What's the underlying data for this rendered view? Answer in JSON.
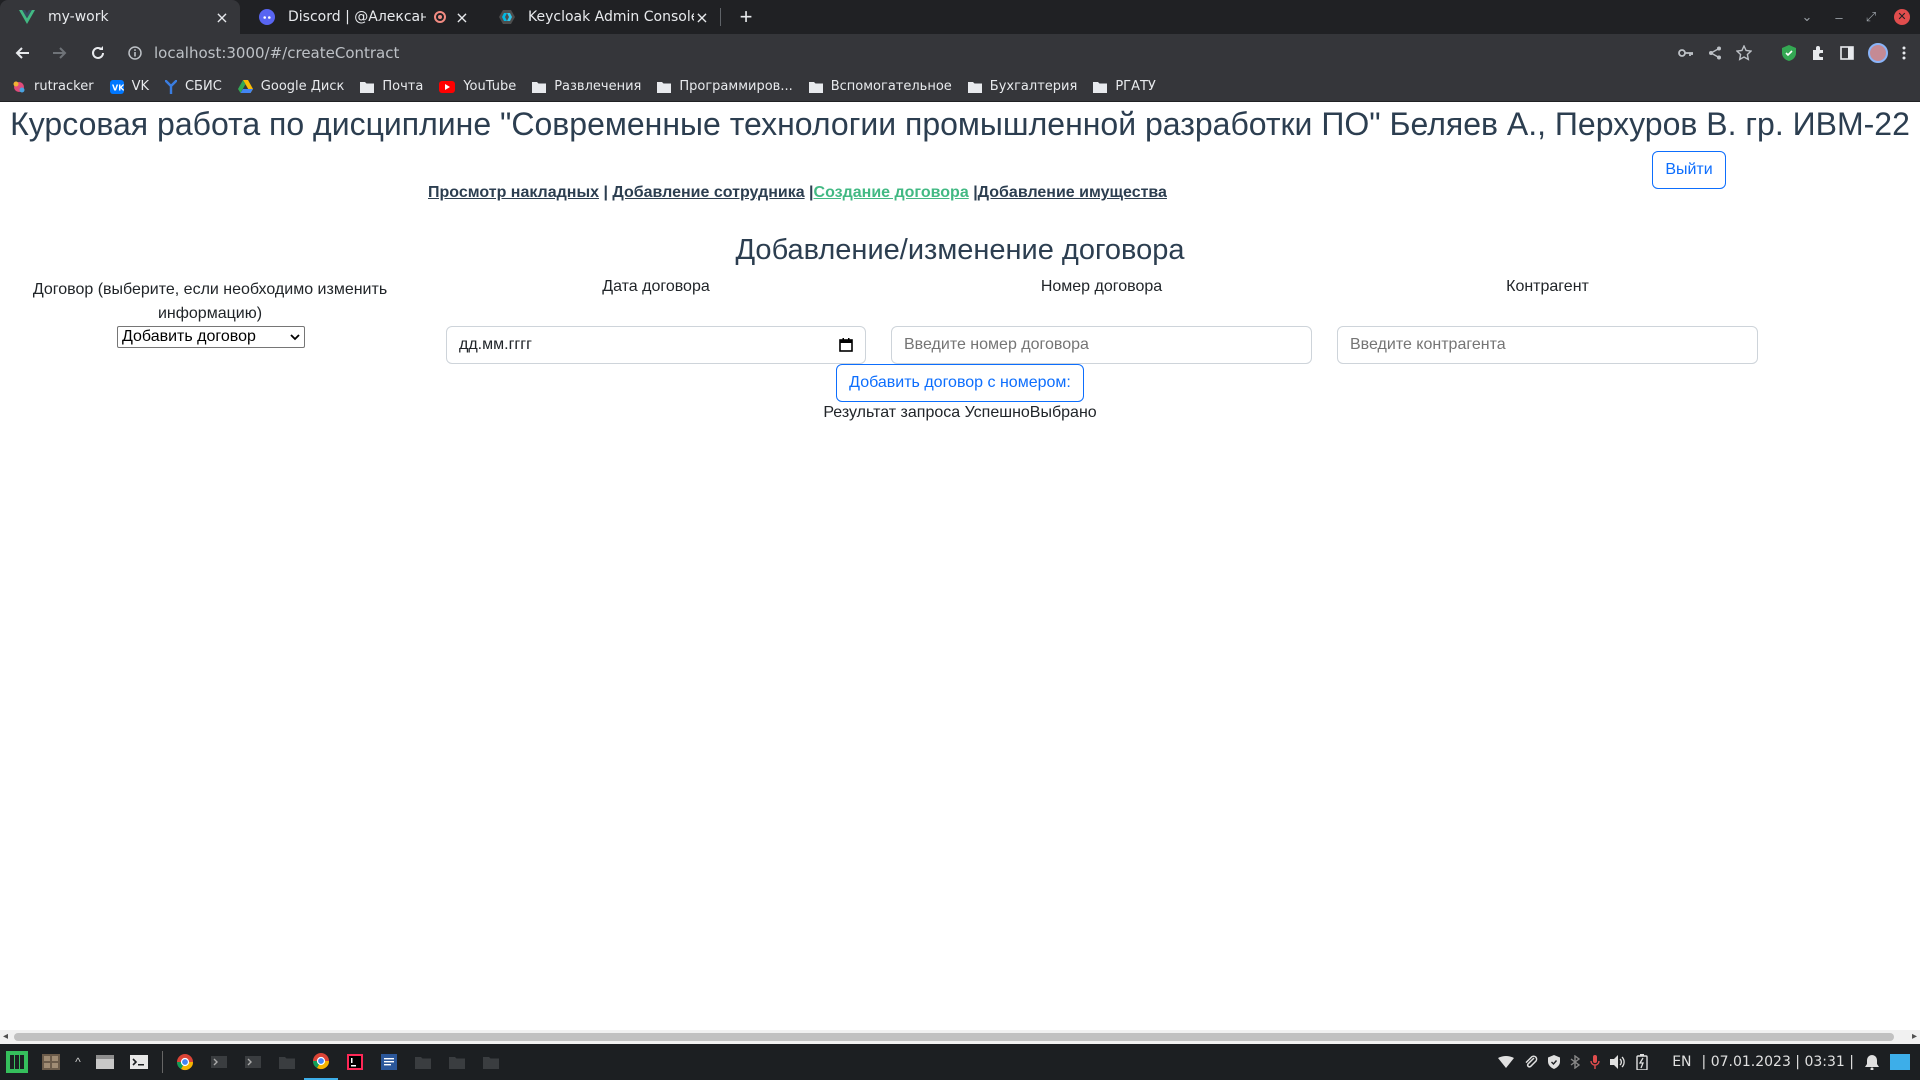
{
  "browser": {
    "tabs": [
      {
        "title": "my-work",
        "favicon": "vue-icon",
        "active": true
      },
      {
        "title": "Discord | @Александр Б",
        "favicon": "discord-icon",
        "recording": true
      },
      {
        "title": "Keycloak Admin Console",
        "favicon": "keycloak-icon"
      }
    ],
    "url": "localhost:3000/#/createContract",
    "bookmarks": [
      {
        "label": "rutracker",
        "icon": "rutracker-icon"
      },
      {
        "label": "VK",
        "icon": "vk-icon"
      },
      {
        "label": "СБИС",
        "icon": "sbis-icon"
      },
      {
        "label": "Google Диск",
        "icon": "google-drive-icon"
      },
      {
        "label": "Почта",
        "icon": "folder-icon"
      },
      {
        "label": "YouTube",
        "icon": "youtube-icon"
      },
      {
        "label": "Развлечения",
        "icon": "folder-icon"
      },
      {
        "label": "Программиров...",
        "icon": "folder-icon"
      },
      {
        "label": "Вспомогательное",
        "icon": "folder-icon"
      },
      {
        "label": "Бухгалтерия",
        "icon": "folder-icon"
      },
      {
        "label": "РГАТУ",
        "icon": "folder-icon"
      }
    ]
  },
  "page": {
    "title": "Курсовая работа по дисциплине \"Современные технологии промышленной разработки ПО\" Беляев А., Перхуров В. гр. ИВМ-22",
    "logout_label": "Выйти",
    "nav": {
      "links": [
        "Просмотр накладных",
        "Добавление сотрудника",
        "Создание договора",
        "Добавление имущества"
      ],
      "separators": [
        "|",
        "|",
        "|"
      ],
      "active_index": 2
    },
    "form": {
      "title": "Добавление/изменение договора",
      "contract_label": "Договор (выберите, если необходимо изменить информацию)",
      "contract_select_value": "Добавить договор",
      "date_label": "Дата договора",
      "date_placeholder": "дд.мм.гггг",
      "number_label": "Номер договора",
      "number_placeholder": "Введите номер договора",
      "counterparty_label": "Контрагент",
      "counterparty_placeholder": "Введите контрагента",
      "submit_label": "Добавить договор с номером:",
      "result_text": "Результат запроса УспешноВыбрано"
    }
  },
  "taskbar": {
    "language": "EN",
    "datetime": "| 07.01.2023 | 03:31 |"
  },
  "colors": {
    "accent_active_link": "#42b983",
    "button_primary": "#0d6efd",
    "text": "#2c3e50"
  }
}
